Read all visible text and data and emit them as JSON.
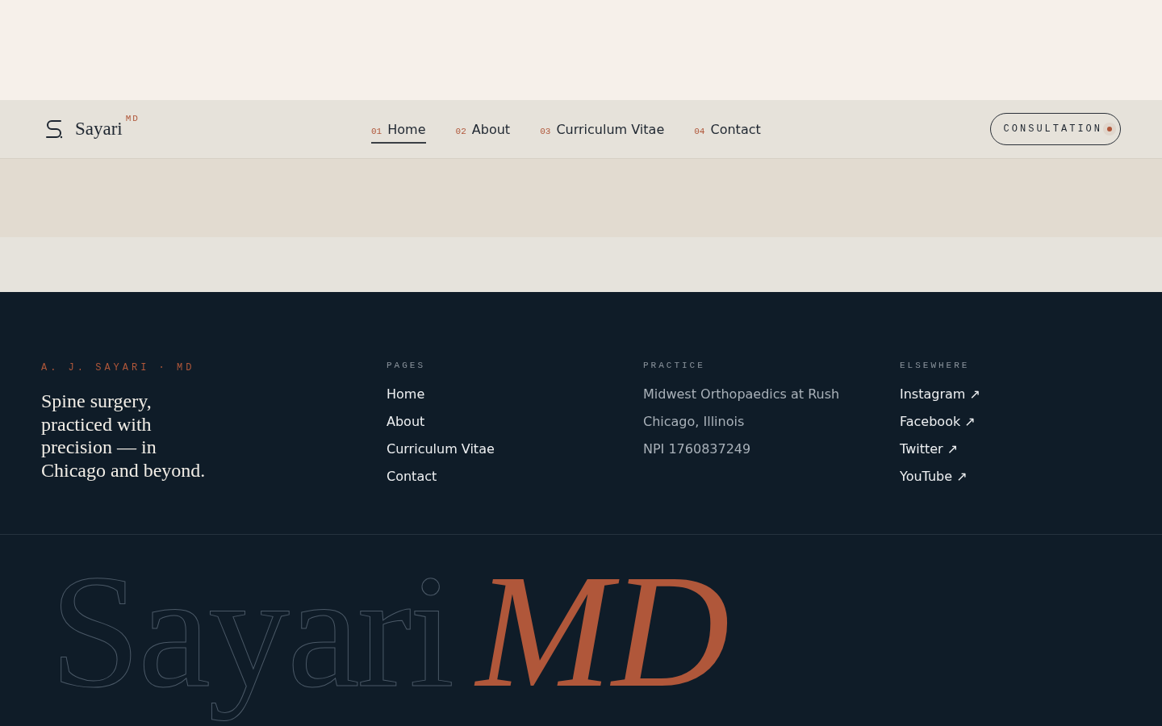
{
  "header": {
    "brand": "Sayari",
    "brand_suffix": "MD",
    "nav": [
      {
        "number": "01",
        "label": "Home",
        "selected": true
      },
      {
        "number": "02",
        "label": "About",
        "selected": false
      },
      {
        "number": "03",
        "label": "Curriculum Vitae",
        "selected": false
      },
      {
        "number": "04",
        "label": "Contact",
        "selected": false
      }
    ],
    "cta": "CONSULTATION"
  },
  "footer": {
    "eyebrow": "A. J. SAYARI · MD",
    "tagline": "Spine surgery, practiced with precision — in Chicago and beyond.",
    "columns": [
      {
        "heading": "PAGES",
        "kind": "links",
        "items": [
          "Home",
          "About",
          "Curriculum Vitae",
          "Contact"
        ]
      },
      {
        "heading": "PRACTICE",
        "kind": "info",
        "items": [
          "Midwest Orthopaedics at Rush",
          "Chicago, Illinois",
          "NPI 1760837249"
        ]
      },
      {
        "heading": "ELSEWHERE",
        "kind": "links",
        "items": [
          "Instagram ↗",
          "Facebook ↗",
          "Twitter ↗",
          "YouTube ↗"
        ]
      }
    ],
    "wordmark": {
      "outline": "Sayari",
      "solid": "MD"
    }
  }
}
